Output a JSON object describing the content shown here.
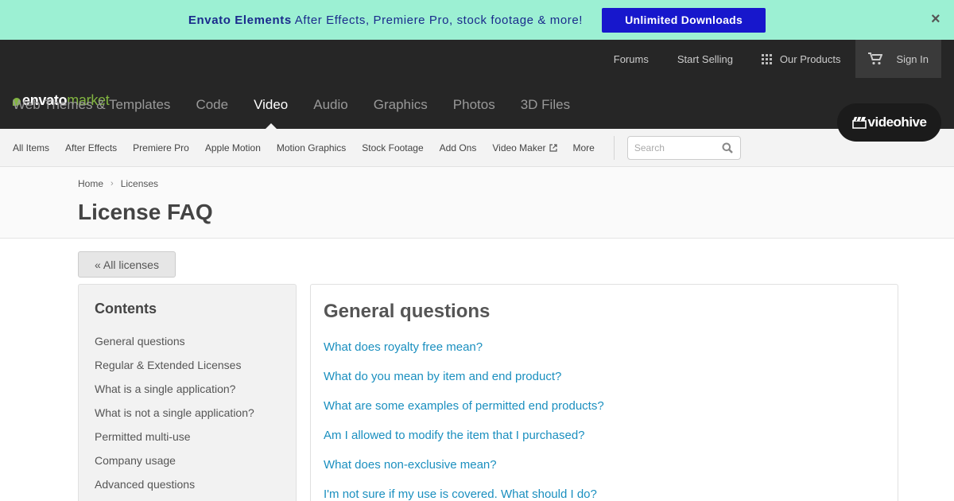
{
  "promo": {
    "brand": "Envato Elements",
    "text": " After Effects, Premiere Pro, stock footage & more!",
    "button": "Unlimited Downloads",
    "close": "×"
  },
  "logo": {
    "envato": "envato",
    "market": "market"
  },
  "top_links": {
    "forums": "Forums",
    "start_selling": "Start Selling",
    "our_products": "Our Products",
    "sign_in": "Sign In"
  },
  "categories": [
    "Web Themes & Templates",
    "Code",
    "Video",
    "Audio",
    "Graphics",
    "Photos",
    "3D Files"
  ],
  "active_category": "Video",
  "site_badge": "videohive",
  "subnav": {
    "items": [
      "All Items",
      "After Effects",
      "Premiere Pro",
      "Apple Motion",
      "Motion Graphics",
      "Stock Footage",
      "Add Ons",
      "Video Maker",
      "More"
    ],
    "search_placeholder": "Search"
  },
  "breadcrumb": {
    "home": "Home",
    "current": "Licenses"
  },
  "page_title": "License FAQ",
  "back_button": "« All licenses",
  "contents": {
    "title": "Contents",
    "items": [
      "General questions",
      "Regular & Extended Licenses",
      "What is a single application?",
      "What is not a single application?",
      "Permitted multi-use",
      "Company usage",
      "Advanced questions"
    ]
  },
  "panel": {
    "title": "General questions",
    "links": [
      "What does royalty free mean?",
      "What do you mean by item and end product?",
      "What are some examples of permitted end products?",
      "Am I allowed to modify the item that I purchased?",
      "What does non-exclusive mean?",
      "I'm not sure if my use is covered. What should I do?"
    ]
  },
  "colors": {
    "promo_bg": "#9cf0d3",
    "promo_button": "#1717cc",
    "header_bg": "#262626",
    "brand_green": "#82b541",
    "link_blue": "#1a8fbf"
  }
}
